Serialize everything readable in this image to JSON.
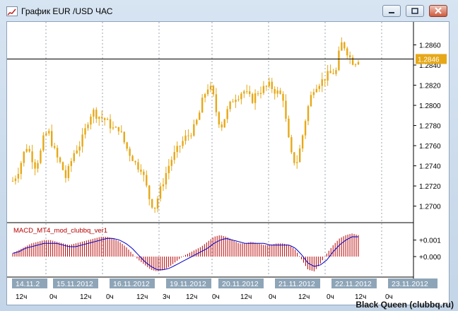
{
  "window": {
    "title": "График EUR /USD  ЧАС",
    "buttons": [
      "minimize-icon",
      "restore-icon",
      "close-icon"
    ]
  },
  "footer": {
    "brand": "Black Queen (clubbq.ru)"
  },
  "colors": {
    "candles": "#e6a817",
    "macd_hist": "#b80000",
    "macd_signal": "#0000c8",
    "price_line": "#000000",
    "price_badge": "#e6a817",
    "date_label_bg": "#8ea5b8"
  },
  "chart_data": [
    {
      "type": "candlestick",
      "title": "",
      "ylim": [
        1.2685,
        1.288
      ],
      "y_ticks": [
        "1.2860",
        "1.2840",
        "1.2820",
        "1.2800",
        "1.2780",
        "1.2760",
        "1.2740",
        "1.2720",
        "1.2700"
      ],
      "current_price": "1.2846",
      "close_path": [
        1.2725,
        1.2732,
        1.2745,
        1.276,
        1.2752,
        1.274,
        1.2748,
        1.2768,
        1.2775,
        1.276,
        1.2748,
        1.274,
        1.2728,
        1.2742,
        1.2755,
        1.276,
        1.277,
        1.2785,
        1.2795,
        1.279,
        1.2788,
        1.2785,
        1.278,
        1.2775,
        1.2778,
        1.2765,
        1.2755,
        1.2748,
        1.274,
        1.2738,
        1.2722,
        1.2705,
        1.2698,
        1.2712,
        1.2725,
        1.2738,
        1.2748,
        1.2755,
        1.2762,
        1.2768,
        1.2772,
        1.2778,
        1.279,
        1.2808,
        1.2818,
        1.2815,
        1.2792,
        1.2778,
        1.279,
        1.28,
        1.2808,
        1.281,
        1.2815,
        1.281,
        1.2805,
        1.2812,
        1.2815,
        1.2818,
        1.282,
        1.2815,
        1.2812,
        1.2808,
        1.2772,
        1.2748,
        1.2742,
        1.276,
        1.2785,
        1.2805,
        1.2818,
        1.2822,
        1.2825,
        1.283,
        1.2832,
        1.2834,
        1.2862,
        1.2858,
        1.2848,
        1.2842,
        1.2846
      ]
    },
    {
      "type": "bar",
      "title": "MACD_MT4_mod_clubbq_ver1",
      "ylim": [
        -0.0012,
        0.0018
      ],
      "y_ticks": [
        "+0.001",
        "+0.000"
      ],
      "hist_path": [
        0.0002,
        0.0004,
        0.0006,
        0.0008,
        0.0009,
        0.001,
        0.001,
        0.0009,
        0.0008,
        0.0007,
        0.0008,
        0.0009,
        0.001,
        0.0011,
        0.0012,
        0.0012,
        0.0011,
        0.0009,
        0.0006,
        0.0002,
        -0.0002,
        -0.0005,
        -0.0008,
        -0.0009,
        -0.0008,
        -0.0006,
        -0.0003,
        0.0,
        0.0002,
        0.0004,
        0.0006,
        0.0009,
        0.0012,
        0.0013,
        0.0012,
        0.001,
        0.0008,
        0.0008,
        0.0009,
        0.0008,
        0.0007,
        0.0007,
        0.0008,
        0.0008,
        0.0007,
        0.0004,
        -0.0002,
        -0.0008,
        -0.0009,
        -0.0004,
        0.0002,
        0.0007,
        0.0011,
        0.0013,
        0.0014,
        0.0013
      ],
      "signal_path": [
        0.0002,
        0.0003,
        0.0005,
        0.0006,
        0.0007,
        0.0008,
        0.0008,
        0.0008,
        0.0007,
        0.0006,
        0.0006,
        0.0007,
        0.0008,
        0.0009,
        0.001,
        0.0011,
        0.0011,
        0.001,
        0.0008,
        0.0005,
        0.0001,
        -0.0003,
        -0.0006,
        -0.0008,
        -0.0008,
        -0.0007,
        -0.0005,
        -0.0003,
        -0.0001,
        0.0001,
        0.0003,
        0.0005,
        0.0008,
        0.001,
        0.0011,
        0.001,
        0.0009,
        0.0008,
        0.0008,
        0.0008,
        0.0008,
        0.0007,
        0.0007,
        0.0007,
        0.0007,
        0.0005,
        0.0001,
        -0.0004,
        -0.0006,
        -0.0005,
        -0.0002,
        0.0003,
        0.0007,
        0.001,
        0.0012,
        0.0012
      ]
    }
  ],
  "time_axis": {
    "dates": [
      "14.11.2",
      "15.11.2012",
      "16.11.2012",
      "19.11.2012",
      "20.11.2012",
      "21.11.2012",
      "22.11.2012",
      "23.11.2012"
    ],
    "hours": [
      "12ч",
      "0ч",
      "12ч",
      "0ч",
      "12ч",
      "3ч",
      "12ч",
      "0ч",
      "12ч",
      "0ч",
      "12ч",
      "0ч",
      "12ч",
      "0ч"
    ]
  }
}
